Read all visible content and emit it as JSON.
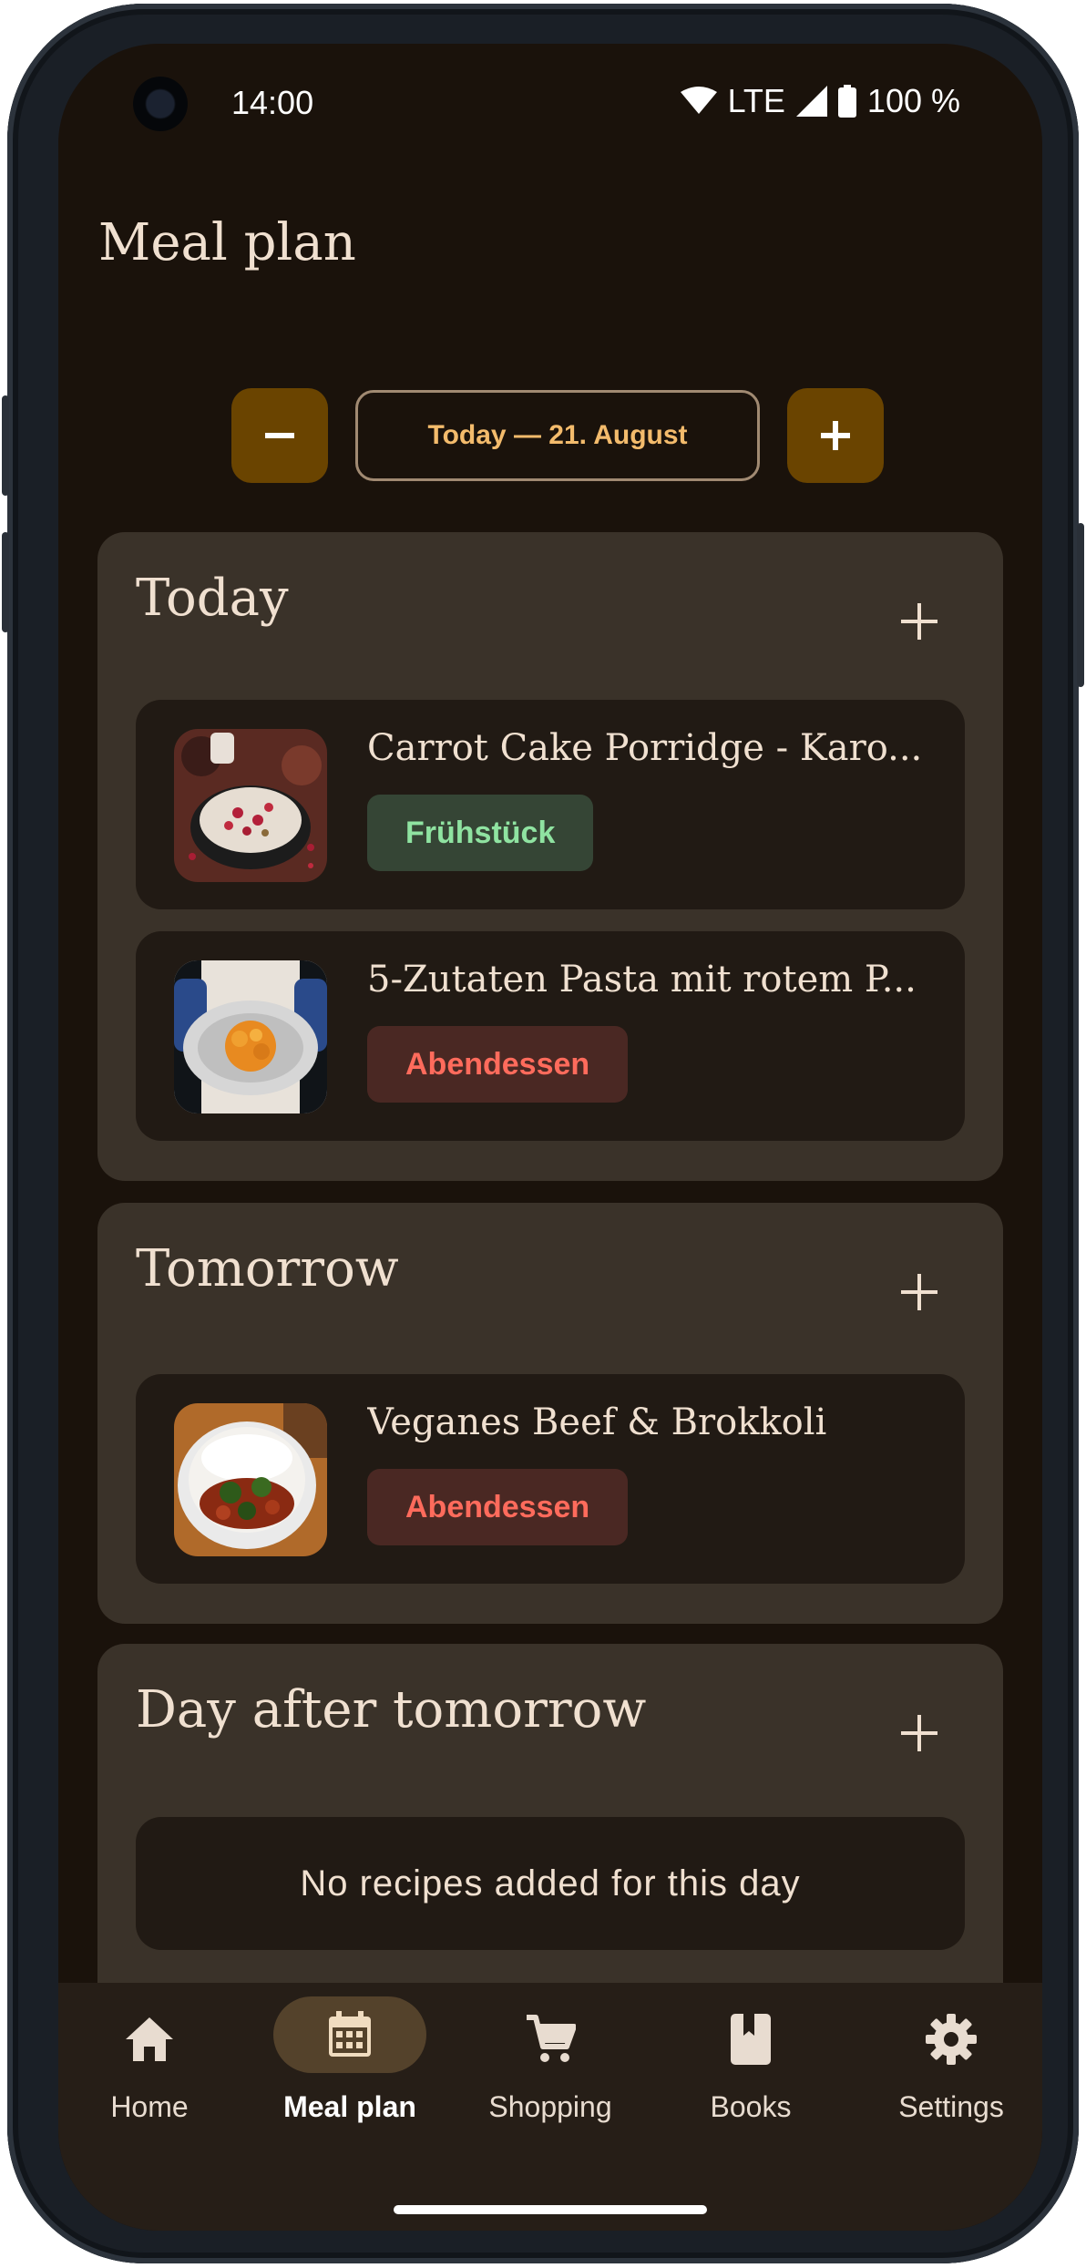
{
  "status": {
    "time": "14:00",
    "network": "LTE",
    "battery": "100 %"
  },
  "page": {
    "title": "Meal plan"
  },
  "date_nav": {
    "label": "Today — 21. August"
  },
  "days": [
    {
      "title": "Today",
      "recipes": [
        {
          "name": "Carrot Cake Porridge - Karo...",
          "tag": "Frühstück"
        },
        {
          "name": "5-Zutaten Pasta mit rotem P...",
          "tag": "Abendessen"
        }
      ]
    },
    {
      "title": "Tomorrow",
      "recipes": [
        {
          "name": "Veganes Beef & Brokkoli",
          "tag": "Abendessen"
        }
      ]
    },
    {
      "title": "Day after tomorrow",
      "empty_text": "No recipes added for this day"
    }
  ],
  "nav": {
    "items": [
      {
        "label": "Home",
        "icon": "home-icon"
      },
      {
        "label": "Meal plan",
        "icon": "calendar-icon",
        "active": true
      },
      {
        "label": "Shopping",
        "icon": "cart-icon"
      },
      {
        "label": "Books",
        "icon": "book-icon"
      },
      {
        "label": "Settings",
        "icon": "gear-icon"
      }
    ]
  },
  "colors": {
    "background": "#1a120b",
    "card": "#3a3229",
    "accent": "#6a4400",
    "accent_text": "#f3bb6c",
    "breakfast_tag": "#8fe3a1",
    "dinner_tag": "#ff6b5c"
  }
}
